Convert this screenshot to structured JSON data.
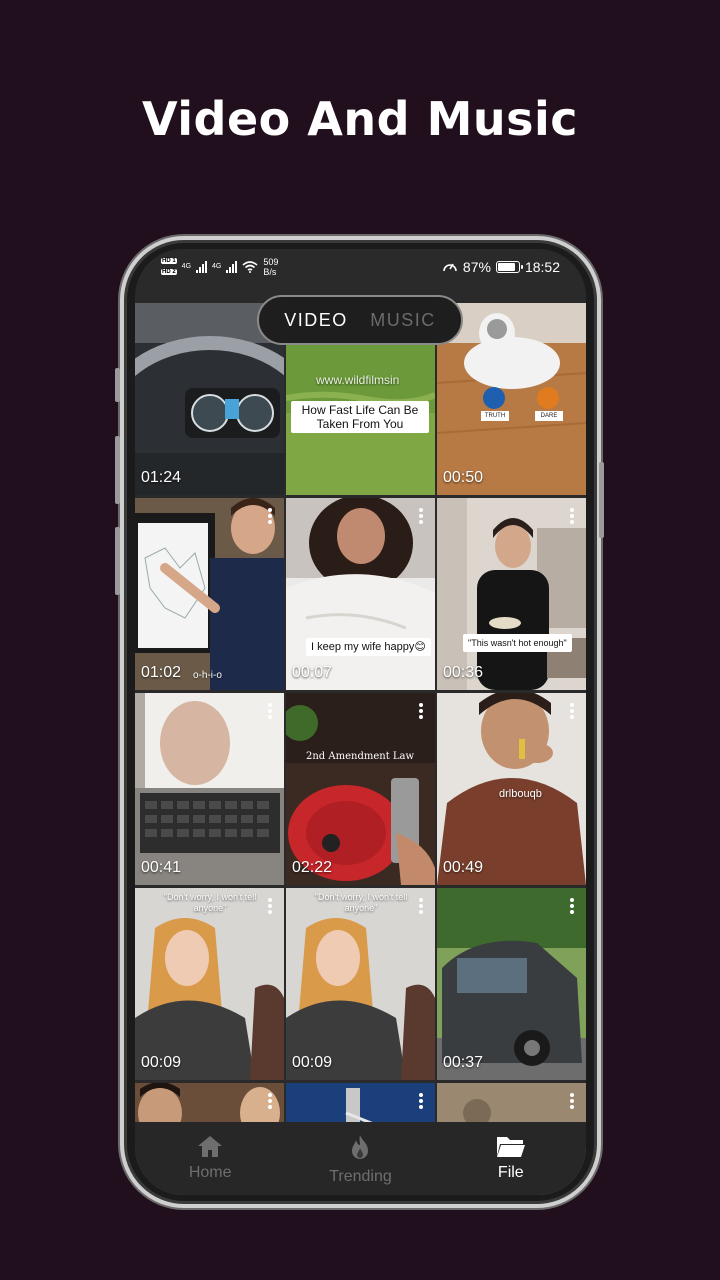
{
  "headline": "Video And Music",
  "status_bar": {
    "sim1": "HD 1",
    "sim2": "HD 2",
    "network1": "4G",
    "network2": "4G",
    "net_speed_value": "509",
    "net_speed_unit": "B/s",
    "battery_percent": "87%",
    "battery_level": 0.87,
    "time": "18:52"
  },
  "tabs": {
    "video": "VIDEO",
    "music": "MUSIC",
    "active": "video"
  },
  "videos": [
    {
      "duration": "01:24"
    },
    {
      "duration": "",
      "caption": "How Fast Life Can Be Taken From You",
      "watermark": "www.wildfilmsin"
    },
    {
      "duration": "00:50",
      "label_left": "TRUTH",
      "label_right": "DARE"
    },
    {
      "duration": "01:02",
      "overlay": "o-h-i-o"
    },
    {
      "duration": "00:07",
      "caption": "I keep my wife happy😊"
    },
    {
      "duration": "00:36",
      "caption": "\"This wasn't hot enough\""
    },
    {
      "duration": "00:41"
    },
    {
      "duration": "02:22",
      "overlay": "2nd Amendment Law"
    },
    {
      "duration": "00:49",
      "shirt_text": "drlbouqb"
    },
    {
      "duration": "00:09",
      "overlay": "\"Don't worry, I won't tell anyone\""
    },
    {
      "duration": "00:09",
      "overlay": "\"Don't worry, I won't tell anyone\""
    },
    {
      "duration": "00:37"
    },
    {
      "duration": ""
    },
    {
      "duration": ""
    },
    {
      "duration": ""
    }
  ],
  "nav": {
    "home": "Home",
    "trending": "Trending",
    "file": "File",
    "active": "file"
  },
  "colors": {
    "background": "#210f1d",
    "nav_bg": "#272727",
    "active": "#ffffff",
    "inactive": "#6e6e6e"
  }
}
